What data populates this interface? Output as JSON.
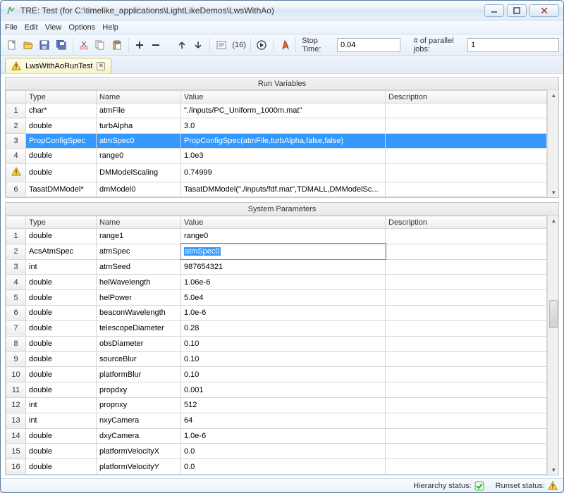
{
  "window": {
    "title": "TRE:  Test (for C:\\timelike_applications\\LightLikeDemos\\LwsWithAo)"
  },
  "menu": {
    "items": [
      "File",
      "Edit",
      "View",
      "Options",
      "Help"
    ]
  },
  "toolbar": {
    "macro_count": "(16)",
    "stop_time_label": "Stop Time:",
    "stop_time_value": "0.04",
    "parallel_label": "# of parallel jobs:",
    "parallel_value": "1"
  },
  "tab": {
    "label": "LwsWithAoRunTest"
  },
  "panels": {
    "run_variables": {
      "title": "Run Variables",
      "columns": [
        "",
        "Type",
        "Name",
        "Value",
        "Description"
      ],
      "rows": [
        {
          "n": "1",
          "type": "char*",
          "name": "atmFile",
          "value": "\"./inputs/PC_Uniform_1000m.mat\"",
          "desc": ""
        },
        {
          "n": "2",
          "type": "double",
          "name": "turbAlpha",
          "value": "3.0",
          "desc": ""
        },
        {
          "n": "3",
          "type": "PropConfigSpec",
          "name": "atmSpec0",
          "value": "PropConfigSpec(atmFile,turbAlpha,false,false)",
          "desc": "",
          "selected": true
        },
        {
          "n": "4",
          "type": "double",
          "name": "range0",
          "value": "1.0e3",
          "desc": ""
        },
        {
          "n": "warn",
          "type": "double",
          "name": "DMModelScaling",
          "value": "0.74999",
          "desc": ""
        },
        {
          "n": "6",
          "type": "TasatDMModel*",
          "name": "dmModel0",
          "value": "TasatDMModel(\"./inputs/fdf.mat\",TDMALL,DMModelSc...",
          "desc": ""
        }
      ]
    },
    "system_parameters": {
      "title": "System Parameters",
      "columns": [
        "",
        "Type",
        "Name",
        "Value",
        "Description"
      ],
      "rows": [
        {
          "n": "1",
          "type": "double",
          "name": "range1",
          "value": "range0",
          "desc": ""
        },
        {
          "n": "2",
          "type": "AcsAtmSpec",
          "name": "atmSpec",
          "value": "atmSpec0",
          "desc": "",
          "editing": true
        },
        {
          "n": "3",
          "type": "int",
          "name": "atmSeed",
          "value": "987654321",
          "desc": ""
        },
        {
          "n": "4",
          "type": "double",
          "name": "helWavelength",
          "value": "1.06e-6",
          "desc": ""
        },
        {
          "n": "5",
          "type": "double",
          "name": "helPower",
          "value": "5.0e4",
          "desc": ""
        },
        {
          "n": "6",
          "type": "double",
          "name": "beaconWavelength",
          "value": "1.0e-6",
          "desc": ""
        },
        {
          "n": "7",
          "type": "double",
          "name": "telescopeDiameter",
          "value": "0.28",
          "desc": ""
        },
        {
          "n": "8",
          "type": "double",
          "name": "obsDiameter",
          "value": "0.10",
          "desc": ""
        },
        {
          "n": "9",
          "type": "double",
          "name": "sourceBlur",
          "value": "0.10",
          "desc": ""
        },
        {
          "n": "10",
          "type": "double",
          "name": "platformBlur",
          "value": "0.10",
          "desc": ""
        },
        {
          "n": "11",
          "type": "double",
          "name": "propdxy",
          "value": "0.001",
          "desc": ""
        },
        {
          "n": "12",
          "type": "int",
          "name": "propnxy",
          "value": "512",
          "desc": ""
        },
        {
          "n": "13",
          "type": "int",
          "name": "nxyCamera",
          "value": "64",
          "desc": ""
        },
        {
          "n": "14",
          "type": "double",
          "name": "dxyCamera",
          "value": "1.0e-6",
          "desc": ""
        },
        {
          "n": "15",
          "type": "double",
          "name": "platformVelocityX",
          "value": "0.0",
          "desc": ""
        },
        {
          "n": "16",
          "type": "double",
          "name": "platformVelocityY",
          "value": "0.0",
          "desc": ""
        }
      ]
    }
  },
  "status": {
    "hierarchy_label": "Hierarchy status:",
    "runset_label": "Runset status:"
  }
}
